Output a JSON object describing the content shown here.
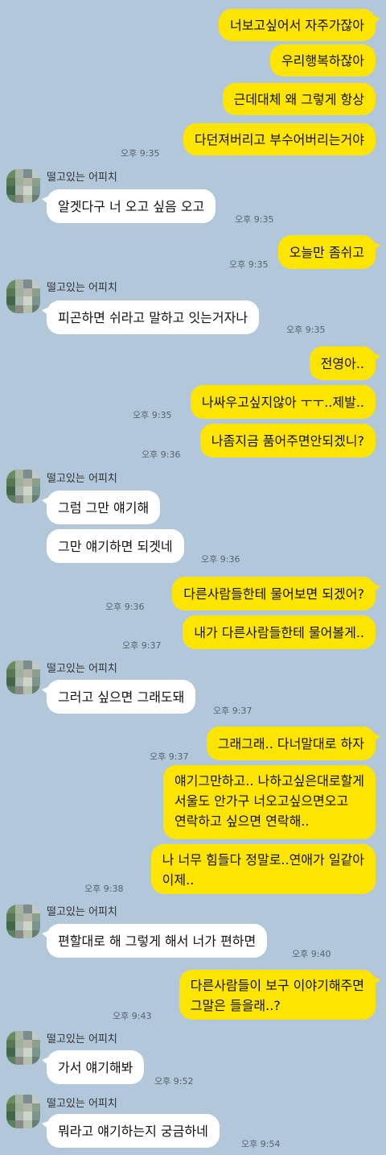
{
  "sender_name": "떨고있는 어피치",
  "messages": {
    "m1": "너보고싶어서 자주가잖아",
    "m2": "우리행복하잖아",
    "m3": "근데대체 왜 그렇게 항상",
    "m4": "다던져버리고 부수어버리는거야",
    "t4": "오후 9:35",
    "m5": "알겟다구 너 오고 싶음 오고",
    "t5": "오후 9:35",
    "m6": "오늘만 좀쉬고",
    "t6": "오후 9:35",
    "m7": "피곤하면 쉬라고 말하고 잇는거자나",
    "t7": "오후 9:35",
    "m8": "전영아..",
    "m9": "나싸우고싶지않아 ㅜㅜ..제발..",
    "t9": "오후 9:35",
    "m10": "나좀지금 품어주면안되겠니?",
    "t10": "오후 9:36",
    "m11": "그럼 그만 얘기해",
    "m12": "그만 얘기하면 되겟네",
    "t12": "오후 9:36",
    "m13": "다른사람들한테 물어보면 되겠어?",
    "t13": "오후 9:36",
    "m14": "내가 다른사람들한테 물어볼게..",
    "t14": "오후 9:37",
    "m15": "그러고 싶으면 그래도돼",
    "t15": "오후 9:37",
    "m16": "그래그래.. 다너말대로 하자",
    "t16": "오후 9:37",
    "m17": "얘기그만하고.. 나하고싶은대로할게\n서울도 안가구 너오고싶으면오고\n연락하고 싶으면 연락해..",
    "m18": "나 너무 힘들다 정말로..연애가 일같아\n이제..",
    "t18": "오후 9:38",
    "m19": "편할대로 해 그렇게 해서 너가 편하면",
    "t19": "오후 9:40",
    "m20": "다른사람들이 보구 이야기해주면\n그말은 들을래..?",
    "t20": "오후 9:43",
    "m21": "가서 얘기해봐",
    "t21": "오후 9:52",
    "m22": "뭐라고 얘기하는지 궁금하네",
    "t22": "오후 9:54"
  },
  "colors": {
    "background": "#b2c7da",
    "my_bubble": "#fee500",
    "their_bubble": "#ffffff"
  },
  "icons": {
    "avatar": "mosaic-avatar-icon"
  }
}
